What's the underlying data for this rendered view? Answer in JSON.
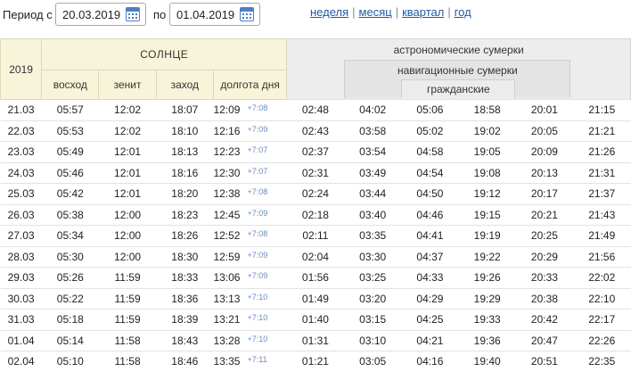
{
  "period": {
    "label": "Период с",
    "from": "20.03.2019",
    "to_label": "по",
    "to": "01.04.2019"
  },
  "links": [
    "неделя",
    "месяц",
    "квартал",
    "год"
  ],
  "colors": {
    "link": "#1e5aa8",
    "sun_header_bg": "#f8f4da",
    "twilight_header_bg": "#ededed",
    "delta": "#6b8cb8"
  },
  "icons": {
    "calendar": "calendar-icon"
  },
  "table": {
    "year": "2019",
    "sun_header": "СОЛНЦЕ",
    "sun_columns": [
      "восход",
      "зенит",
      "заход",
      "долгота дня"
    ],
    "astronomical": "астрономические сумерки",
    "nautical": "навигационные сумерки",
    "civil": "гражданские",
    "rows": [
      {
        "date": "21.03",
        "rise": "05:57",
        "noon": "12:02",
        "set": "18:07",
        "len": "12:09",
        "delta": "+7:08",
        "a1": "02:48",
        "n1": "04:02",
        "c1": "05:06",
        "c2": "18:58",
        "n2": "20:01",
        "a2": "21:15"
      },
      {
        "date": "22.03",
        "rise": "05:53",
        "noon": "12:02",
        "set": "18:10",
        "len": "12:16",
        "delta": "+7:09",
        "a1": "02:43",
        "n1": "03:58",
        "c1": "05:02",
        "c2": "19:02",
        "n2": "20:05",
        "a2": "21:21"
      },
      {
        "date": "23.03",
        "rise": "05:49",
        "noon": "12:01",
        "set": "18:13",
        "len": "12:23",
        "delta": "+7:07",
        "a1": "02:37",
        "n1": "03:54",
        "c1": "04:58",
        "c2": "19:05",
        "n2": "20:09",
        "a2": "21:26"
      },
      {
        "date": "24.03",
        "rise": "05:46",
        "noon": "12:01",
        "set": "18:16",
        "len": "12:30",
        "delta": "+7:07",
        "a1": "02:31",
        "n1": "03:49",
        "c1": "04:54",
        "c2": "19:08",
        "n2": "20:13",
        "a2": "21:31"
      },
      {
        "date": "25.03",
        "rise": "05:42",
        "noon": "12:01",
        "set": "18:20",
        "len": "12:38",
        "delta": "+7:08",
        "a1": "02:24",
        "n1": "03:44",
        "c1": "04:50",
        "c2": "19:12",
        "n2": "20:17",
        "a2": "21:37"
      },
      {
        "date": "26.03",
        "rise": "05:38",
        "noon": "12:00",
        "set": "18:23",
        "len": "12:45",
        "delta": "+7:09",
        "a1": "02:18",
        "n1": "03:40",
        "c1": "04:46",
        "c2": "19:15",
        "n2": "20:21",
        "a2": "21:43"
      },
      {
        "date": "27.03",
        "rise": "05:34",
        "noon": "12:00",
        "set": "18:26",
        "len": "12:52",
        "delta": "+7:08",
        "a1": "02:11",
        "n1": "03:35",
        "c1": "04:41",
        "c2": "19:19",
        "n2": "20:25",
        "a2": "21:49"
      },
      {
        "date": "28.03",
        "rise": "05:30",
        "noon": "12:00",
        "set": "18:30",
        "len": "12:59",
        "delta": "+7:09",
        "a1": "02:04",
        "n1": "03:30",
        "c1": "04:37",
        "c2": "19:22",
        "n2": "20:29",
        "a2": "21:56"
      },
      {
        "date": "29.03",
        "rise": "05:26",
        "noon": "11:59",
        "set": "18:33",
        "len": "13:06",
        "delta": "+7:09",
        "a1": "01:56",
        "n1": "03:25",
        "c1": "04:33",
        "c2": "19:26",
        "n2": "20:33",
        "a2": "22:02"
      },
      {
        "date": "30.03",
        "rise": "05:22",
        "noon": "11:59",
        "set": "18:36",
        "len": "13:13",
        "delta": "+7:10",
        "a1": "01:49",
        "n1": "03:20",
        "c1": "04:29",
        "c2": "19:29",
        "n2": "20:38",
        "a2": "22:10"
      },
      {
        "date": "31.03",
        "rise": "05:18",
        "noon": "11:59",
        "set": "18:39",
        "len": "13:21",
        "delta": "+7:10",
        "a1": "01:40",
        "n1": "03:15",
        "c1": "04:25",
        "c2": "19:33",
        "n2": "20:42",
        "a2": "22:17"
      },
      {
        "date": "01.04",
        "rise": "05:14",
        "noon": "11:58",
        "set": "18:43",
        "len": "13:28",
        "delta": "+7:10",
        "a1": "01:31",
        "n1": "03:10",
        "c1": "04:21",
        "c2": "19:36",
        "n2": "20:47",
        "a2": "22:26"
      },
      {
        "date": "02.04",
        "rise": "05:10",
        "noon": "11:58",
        "set": "18:46",
        "len": "13:35",
        "delta": "+7:11",
        "a1": "01:21",
        "n1": "03:05",
        "c1": "04:16",
        "c2": "19:40",
        "n2": "20:51",
        "a2": "22:35"
      }
    ]
  }
}
